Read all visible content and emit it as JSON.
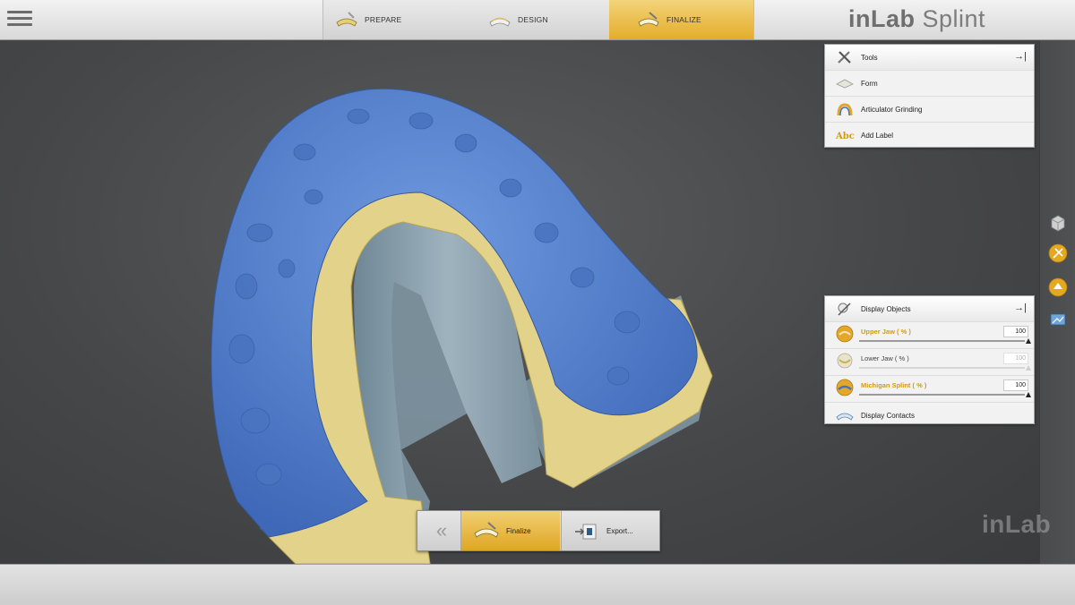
{
  "topbar": {
    "steps": [
      {
        "label": "PREPARE",
        "icon": "prepare-jaw-icon"
      },
      {
        "label": "DESIGN",
        "icon": "design-jaw-icon"
      },
      {
        "label": "FINALIZE",
        "icon": "finalize-jaw-icon",
        "active": true
      }
    ],
    "brand_bold": "inLab",
    "brand_light": " Splint"
  },
  "tools_panel": {
    "title": "Tools",
    "items": [
      {
        "label": "Form",
        "icon": "form-icon"
      },
      {
        "label": "Articulator Grinding",
        "icon": "articulator-icon"
      },
      {
        "label": "Add Label",
        "icon": "abc-label-icon"
      }
    ]
  },
  "display_panel": {
    "title": "Display Objects",
    "items": [
      {
        "label": "Upper Jaw  ( % )",
        "value": "100",
        "active": true
      },
      {
        "label": "Lower Jaw  ( % )",
        "value": "100",
        "active": false
      },
      {
        "label": "Michigan Splint  ( % )",
        "value": "100",
        "active": true
      }
    ],
    "contacts_label": "Display Contacts"
  },
  "command_bar": {
    "back_label": "«",
    "finalize_label": "Finalize",
    "export_label": "Export..."
  },
  "watermark": "inLab",
  "colors": {
    "accent": "#e3ad2a",
    "splint_blue": "#4f7fcf",
    "jaw_yellow": "#e3d38a"
  }
}
